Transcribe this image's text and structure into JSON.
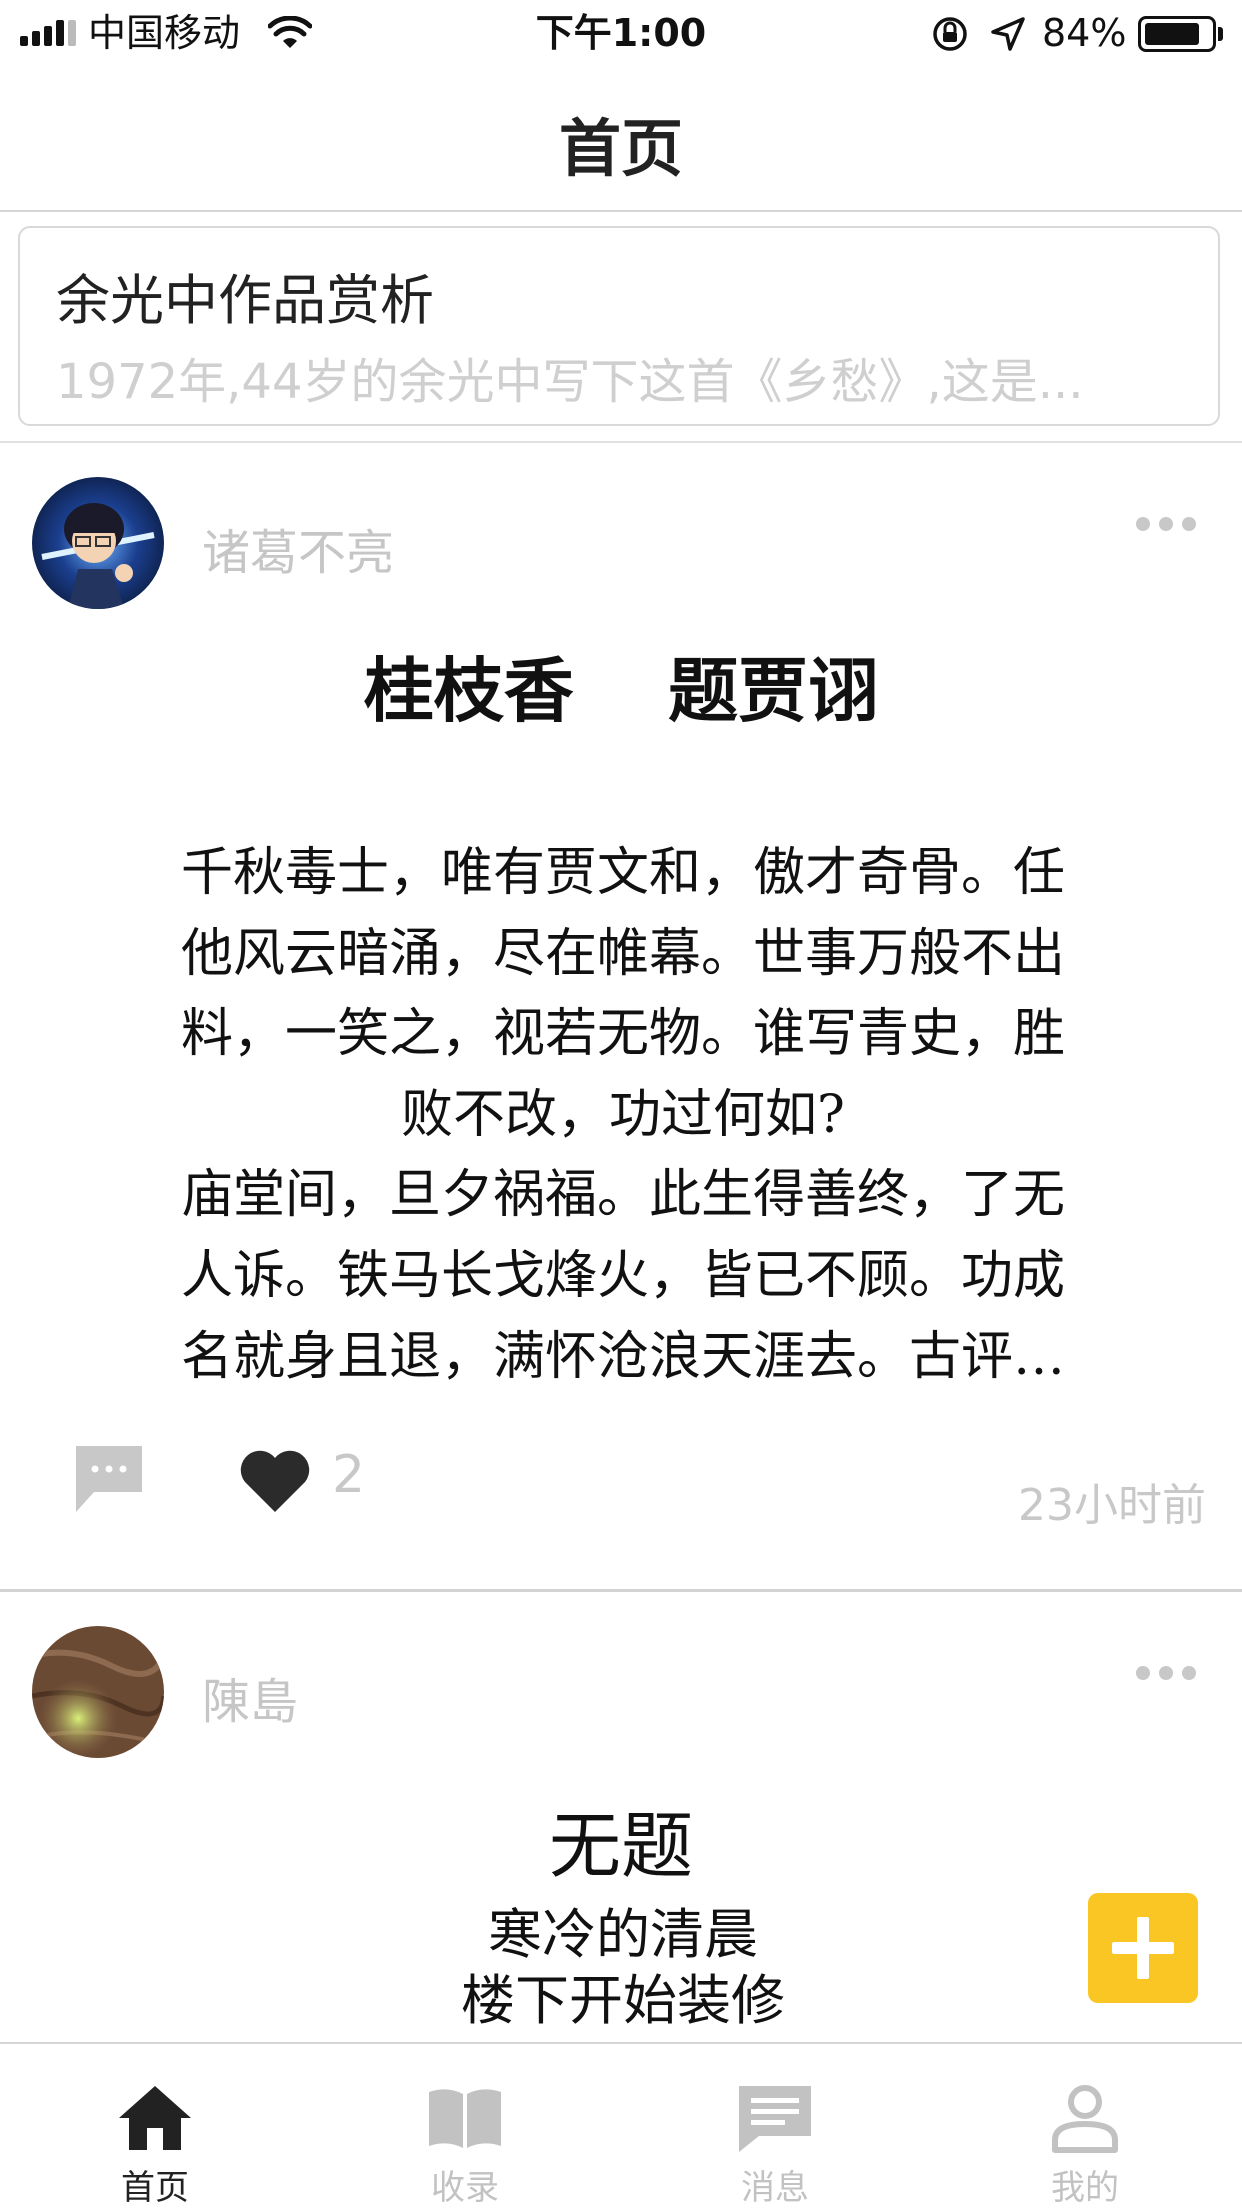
{
  "status_bar": {
    "carrier": "中国移动",
    "time": "下午1:00",
    "battery_percent": "84%",
    "battery_level": 0.84
  },
  "header": {
    "title": "首页"
  },
  "featured": {
    "title": "余光中作品赏析",
    "excerpt": "1972年,44岁的余光中写下这首《乡愁》,这是..."
  },
  "posts": [
    {
      "author": "诸葛不亮",
      "title": "桂枝香　 题贾诩",
      "lines": [
        "千秋毒士，唯有贾文和，傲才奇骨。任",
        "他风云暗涌，尽在帷幕。世事万般不出",
        "料，一笑之，视若无物。谁写青史，胜",
        "败不改，功过何如?",
        "庙堂间，旦夕祸福。此生得善终，了无",
        "人诉。铁马长戈烽火，皆已不顾。功成",
        "名就身且退，满怀沧浪天涯去。古评…"
      ],
      "likes": "2",
      "time": "23小时前"
    },
    {
      "author": "陳島",
      "title": "无题",
      "lines": [
        "寒冷的清晨",
        "楼下开始装修"
      ]
    }
  ],
  "tabs": [
    {
      "label": "首页",
      "icon": "home-icon",
      "active": true
    },
    {
      "label": "收录",
      "icon": "book-icon",
      "active": false
    },
    {
      "label": "消息",
      "icon": "message-icon",
      "active": false
    },
    {
      "label": "我的",
      "icon": "profile-icon",
      "active": false
    }
  ],
  "colors": {
    "accent": "#f9c623",
    "muted_text": "#c6c6c6",
    "active_tab": "#222222",
    "inactive_tab": "#c2c2c2"
  }
}
